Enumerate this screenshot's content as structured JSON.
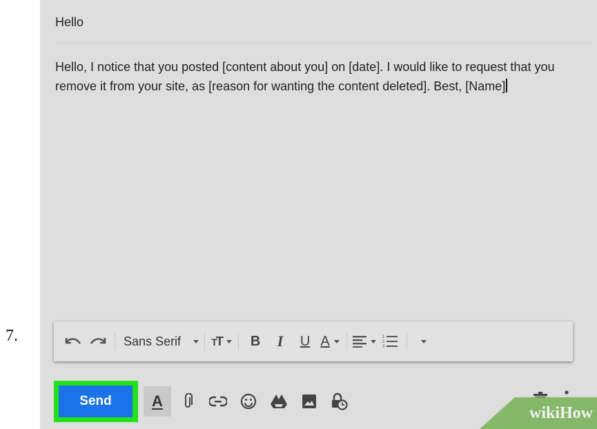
{
  "step": {
    "number": "7."
  },
  "compose": {
    "subject": "Hello",
    "body": "Hello, I notice that you posted [content about you] on [date]. I would like to request that you remove it from your site, as [reason for wanting the content deleted]. Best, [Name]"
  },
  "toolbar": {
    "font_family": "Sans Serif",
    "bold": "B",
    "italic": "I",
    "underline": "U",
    "text_color": "A",
    "icons": [
      "undo-icon",
      "redo-icon",
      "font-size-icon",
      "align-icon",
      "numbered-list-icon",
      "more-formatting-icon"
    ]
  },
  "bottom_bar": {
    "send_label": "Send",
    "formatting_label": "A",
    "icons": [
      "formatting-options-icon",
      "attach-icon",
      "link-icon",
      "emoji-icon",
      "drive-icon",
      "photo-icon",
      "confidential-icon",
      "trash-icon",
      "more-options-icon"
    ]
  },
  "watermark": {
    "brand_wiki": "wiki",
    "brand_how": "How"
  },
  "colors": {
    "send": "#1a73e8",
    "highlight": "#22e11b",
    "watermark": "#86b86a",
    "background": "#dedede"
  }
}
